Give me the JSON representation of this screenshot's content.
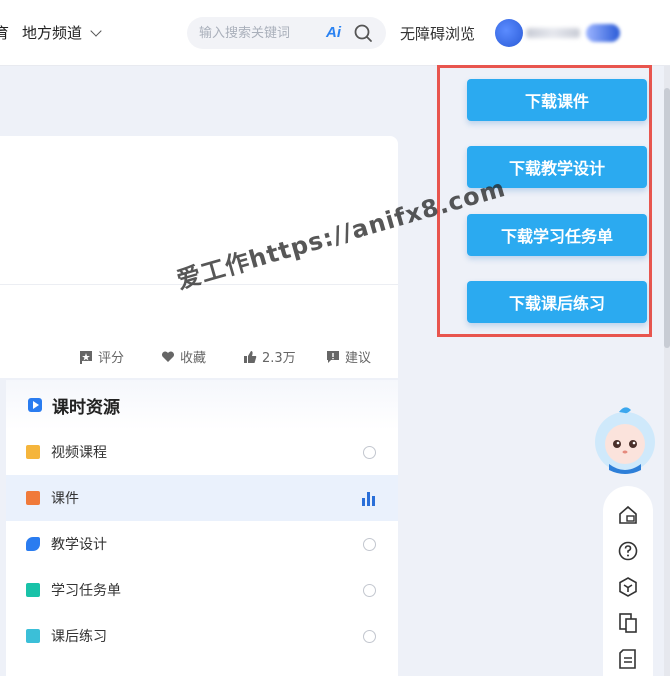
{
  "header": {
    "nav_edu": "育",
    "nav_local": "地方频道",
    "search_placeholder": "输入搜索关键词",
    "ai_label": "Ai",
    "accessibility": "无障碍浏览"
  },
  "course": {
    "actions": {
      "rate": "评分",
      "favorite": "收藏",
      "likes": "2.3万",
      "suggest": "建议"
    }
  },
  "resources": {
    "title": "课时资源",
    "items": [
      {
        "label": "视频课程",
        "icon_color": "#f5b53c",
        "state": "radio"
      },
      {
        "label": "课件",
        "icon_color": "#f07a3a",
        "state": "active"
      },
      {
        "label": "教学设计",
        "icon_color": "#2a7cf0",
        "state": "radio"
      },
      {
        "label": "学习任务单",
        "icon_color": "#19c2a8",
        "state": "radio"
      },
      {
        "label": "课后练习",
        "icon_color": "#3bbfd8",
        "state": "radio"
      }
    ]
  },
  "downloads": {
    "buttons": [
      "下载课件",
      "下载教学设计",
      "下载学习任务单",
      "下载课后练习"
    ],
    "color": "#2baaf0",
    "frame_color": "#e8554e"
  },
  "watermark": "爱工作https://anifx8.com",
  "side_tools": [
    "home-icon",
    "help-icon",
    "cube-icon",
    "copy-icon",
    "document-icon"
  ]
}
